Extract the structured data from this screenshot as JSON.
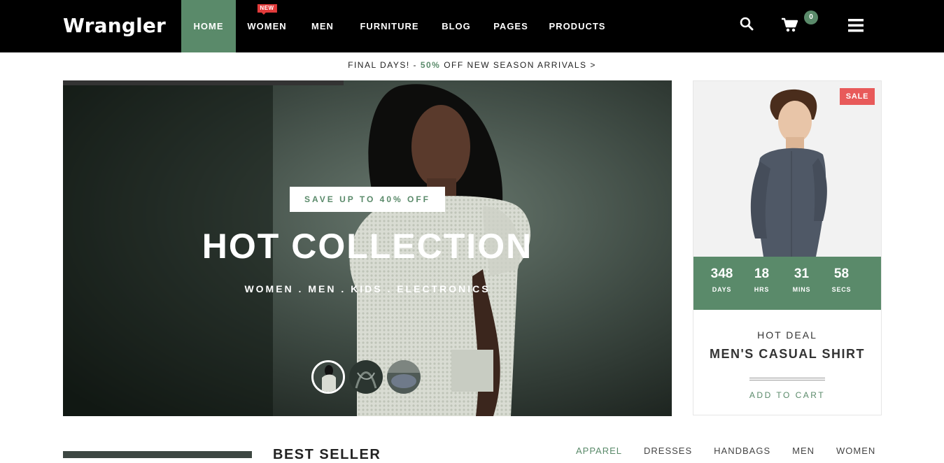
{
  "brand": {
    "name": "Wrangler",
    "accent": "#5a8a6a",
    "sale_red": "#e85a5a"
  },
  "nav": {
    "items": [
      {
        "label": "HOME",
        "active": true,
        "badge": ""
      },
      {
        "label": "WOMEN",
        "active": false,
        "badge": "NEW"
      },
      {
        "label": "MEN",
        "active": false,
        "badge": ""
      },
      {
        "label": "FURNITURE",
        "active": false,
        "badge": ""
      },
      {
        "label": "BLOG",
        "active": false,
        "badge": ""
      },
      {
        "label": "PAGES",
        "active": false,
        "badge": ""
      },
      {
        "label": "PRODUCTS",
        "active": false,
        "badge": ""
      }
    ],
    "icons": [
      "search-icon",
      "cart-icon",
      "menu-icon"
    ],
    "cart_count": "0"
  },
  "promo": {
    "prefix": "FINAL DAYS! - ",
    "percent": "50%",
    "suffix": " OFF NEW SEASON ARRIVALS >"
  },
  "hero": {
    "tag": "SAVE UP TO 40% OFF",
    "title": "HOT COLLECTION",
    "subtitle": "WOMEN . MEN . KIDS . ELECTRONICS",
    "thumbs": [
      "thumb-1",
      "thumb-2",
      "thumb-3"
    ]
  },
  "deal": {
    "badge": "SALE",
    "timer": [
      {
        "value": "348",
        "label": "DAYS"
      },
      {
        "value": "18",
        "label": "HRS"
      },
      {
        "value": "31",
        "label": "MINS"
      },
      {
        "value": "58",
        "label": "SECS"
      }
    ],
    "kicker": "HOT DEAL",
    "title": "MEN'S CASUAL SHIRT",
    "cta": "ADD TO CART"
  },
  "bestseller": {
    "title": "BEST SELLER",
    "filters": [
      "APPAREL",
      "DRESSES",
      "HANDBAGS",
      "MEN",
      "WOMEN"
    ]
  }
}
